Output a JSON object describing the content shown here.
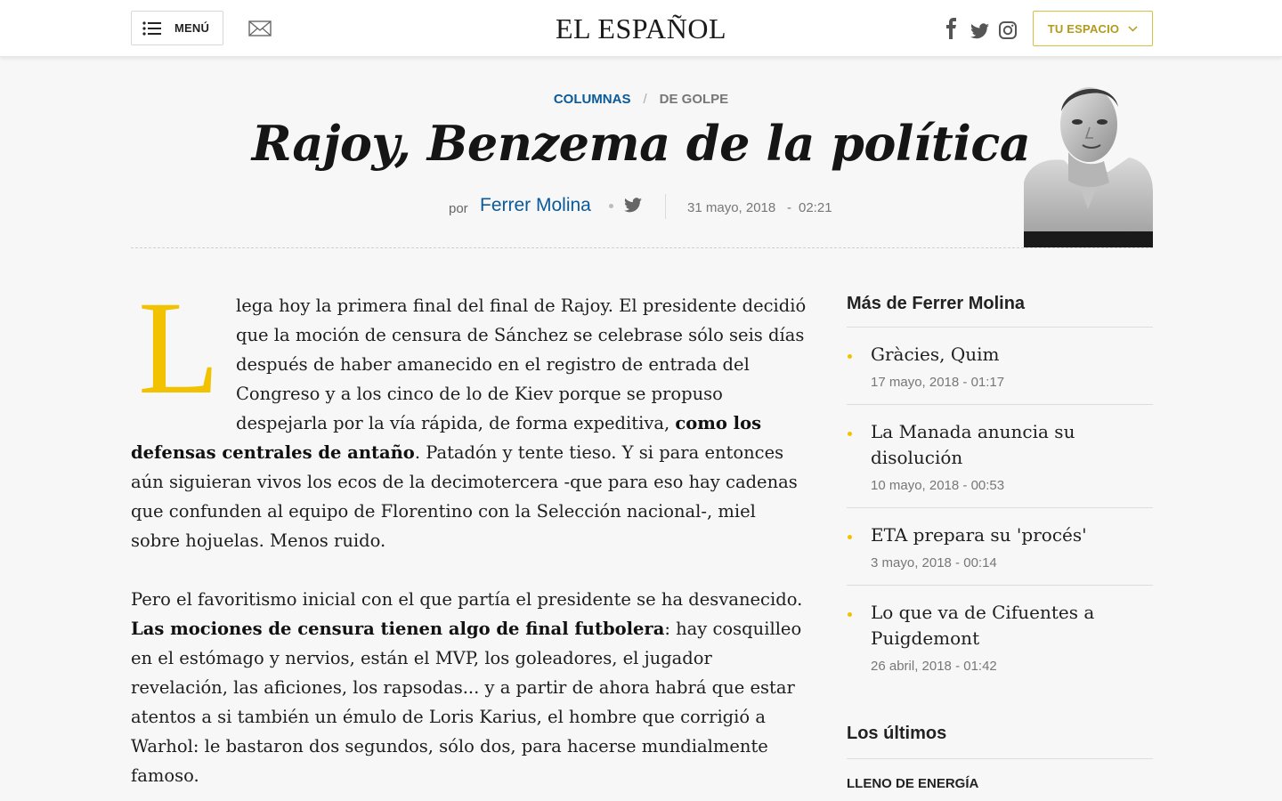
{
  "header": {
    "menu_label": "MENÚ",
    "logo": "EL ESPAÑOL",
    "tu_espacio_label": "TU ESPACIO",
    "icons": [
      "menu-icon",
      "mail-icon",
      "facebook-icon",
      "twitter-icon",
      "instagram-icon",
      "chevron-down-icon"
    ]
  },
  "article": {
    "breadcrumb": {
      "section": "COLUMNAS",
      "separator": "/",
      "subsection": "DE GOLPE"
    },
    "title": "Rajoy, Benzema de la política",
    "byline": {
      "por": "por",
      "author": "Ferrer Molina",
      "date": "31 mayo, 2018",
      "dash": "-",
      "time": "02:21"
    },
    "dropcap": "L",
    "p1": {
      "lead": "lega hoy la primera final del final de Rajoy. El presidente decidió que la moción de censura de Sánchez se celebrase sólo seis días después de haber amanecido en el registro de entrada del Congreso y a los cinco de lo de Kiev porque se propuso despejarla por la vía rápida, de forma expeditiva, ",
      "bold": "como los defensas centrales de antaño",
      "rest": ". Patadón y tente tieso. Y si para entonces aún siguieran vivos los ecos de la decimotercera -que para eso hay cadenas que confunden al equipo de Florentino con la Selección nacional-, miel sobre hojuelas. Menos ruido."
    },
    "p2": {
      "lead": "Pero el favoritismo inicial con el que partía el presidente se ha desvanecido. ",
      "bold": "Las mociones de censura tienen algo de final futbolera",
      "rest": ": hay cosquilleo en el estómago y nervios, están el MVP, los goleadores, el jugador revelación, las aficiones, los rapsodas... y a partir de ahora habrá que estar atentos a si también un émulo de Loris Karius, el hombre que corrigió a Warhol: le bastaron dos segundos, sólo dos, para hacerse mundialmente famoso."
    }
  },
  "sidebar": {
    "more_title": "Más de Ferrer Molina",
    "items": [
      {
        "title": "Gràcies, Quim",
        "date": "17 mayo, 2018  -  01:17"
      },
      {
        "title": "La Manada anuncia su disolución",
        "date": "10 mayo, 2018  -  00:53"
      },
      {
        "title": "ETA prepara su 'procés'",
        "date": "3 mayo, 2018  -  00:14"
      },
      {
        "title": "Lo que va de Cifuentes a Puigdemont",
        "date": "26 abril, 2018  -  01:42"
      }
    ],
    "latest_title": "Los últimos",
    "latest_kicker": "LLENO DE ENERGÍA"
  },
  "colors": {
    "brand_blue": "#0a5a99",
    "accent_yellow": "#f2c200",
    "gold_border": "#d7bf44"
  }
}
